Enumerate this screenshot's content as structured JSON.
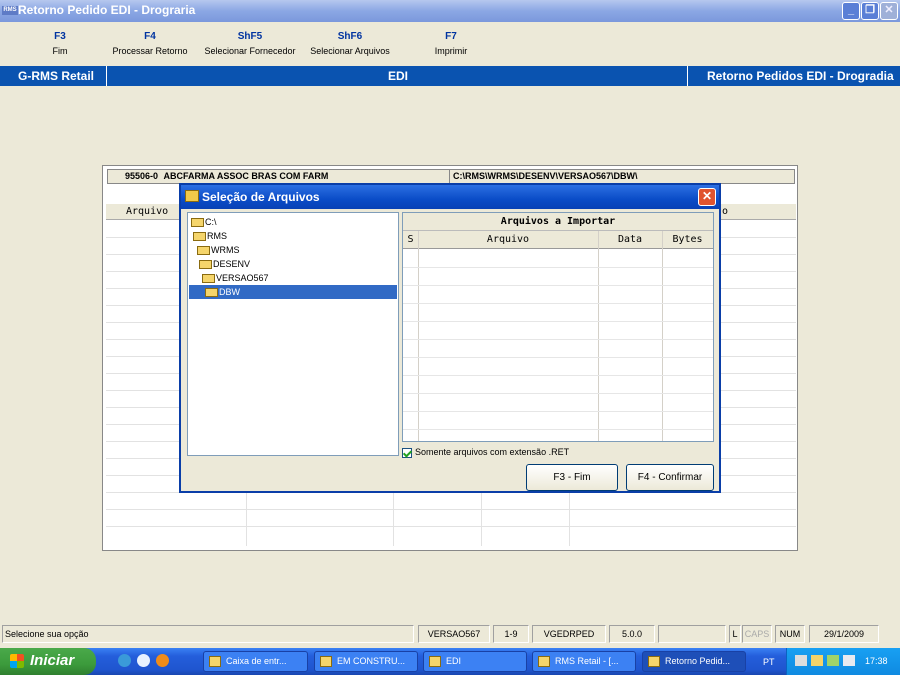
{
  "window": {
    "title": "Retorno Pedido EDI - Drograria",
    "app_icon": "RMS"
  },
  "fkeys": [
    {
      "key": "F3",
      "label": "Fim"
    },
    {
      "key": "F4",
      "label": "Processar Retorno"
    },
    {
      "key": "ShF5",
      "label": "Selecionar Fornecedor"
    },
    {
      "key": "ShF6",
      "label": "Selecionar Arquivos"
    },
    {
      "key": "F7",
      "label": "Imprimir"
    }
  ],
  "banner": {
    "left": "G-RMS Retail",
    "center": "EDI",
    "right": "Retorno Pedidos EDI - Drogradia"
  },
  "background": {
    "supplier_code": "95506-0",
    "supplier_name": "ABCFARMA ASSOC BRAS COM FARM",
    "path": "C:\\RMS\\WRMS\\DESENV\\VERSAO567\\DBW\\",
    "col_arquivo": "Arquivo",
    "col_right_tail": "o"
  },
  "dialog": {
    "title": "Seleção de Arquivos",
    "tree": [
      "C:\\",
      "RMS",
      "WRMS",
      "DESENV",
      "VERSAO567",
      "DBW"
    ],
    "selected_index": 5,
    "grid_title": "Arquivos a Importar",
    "columns": [
      "S",
      "Arquivo",
      "Data",
      "Bytes"
    ],
    "checkbox_label": "Somente arquivos com extensão .RET",
    "checkbox_checked": true,
    "btn_fim": "F3 - Fim",
    "btn_confirm": "F4 - Confirmar"
  },
  "status": {
    "message": "Selecione sua opção",
    "version": "VERSAO567",
    "range": "1-9",
    "program": "VGEDRPED",
    "build": "5.0.0",
    "l": "L",
    "caps": "CAPS",
    "num": "NUM",
    "date": "29/1/2009"
  },
  "taskbar": {
    "start": "Iniciar",
    "tasks": [
      "Caixa de entr...",
      "EM CONSTRU...",
      "EDI",
      "RMS Retail - [...",
      "Retorno Pedid..."
    ],
    "lang": "PT",
    "time": "17:38"
  }
}
